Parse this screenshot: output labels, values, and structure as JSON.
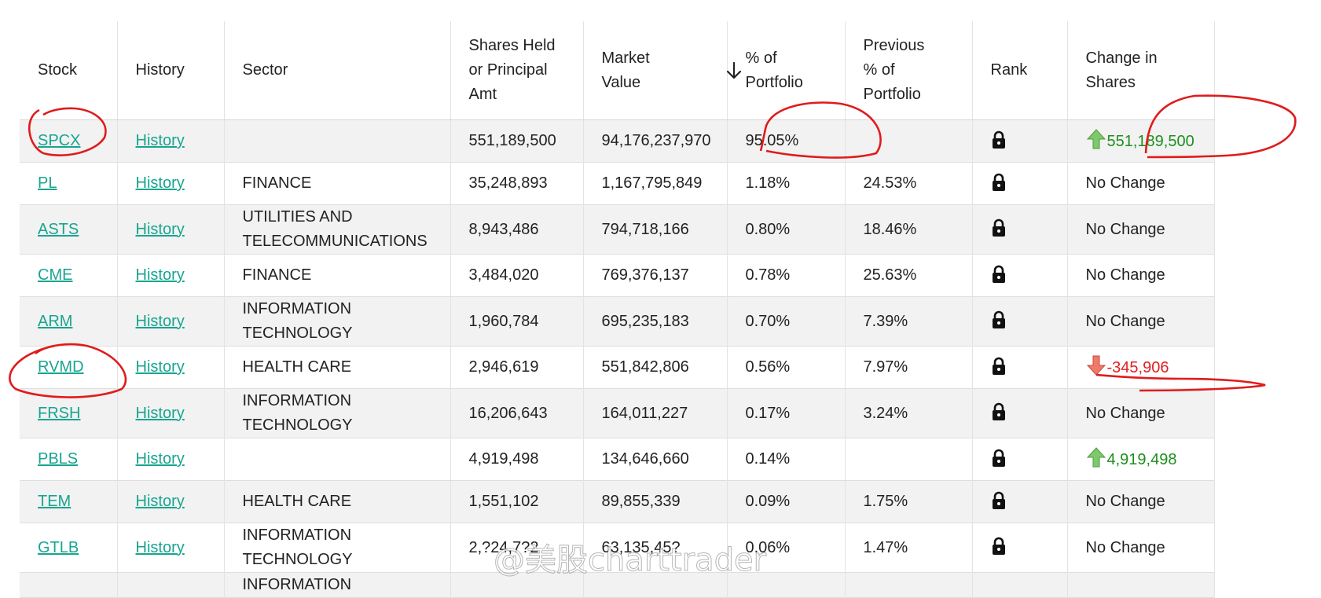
{
  "headers": {
    "stock": "Stock",
    "history": "History",
    "sector": "Sector",
    "shares": "Shares Held or Principal Amt",
    "market_value": "Market Value",
    "pct": "% of Portfolio",
    "prev_pct": "Previous % of Portfolio",
    "rank": "Rank",
    "change": "Change in Shares"
  },
  "rows": [
    {
      "stock": "SPCX",
      "history": "History",
      "sector": "",
      "shares": "551,189,500",
      "market_value": "94,176,237,970",
      "pct": "95.05%",
      "prev_pct": "",
      "change": "551,189,500",
      "change_dir": "up"
    },
    {
      "stock": "PL",
      "history": "History",
      "sector": "FINANCE",
      "shares": "35,248,893",
      "market_value": "1,167,795,849",
      "pct": "1.18%",
      "prev_pct": "24.53%",
      "change": "No Change",
      "change_dir": "none"
    },
    {
      "stock": "ASTS",
      "history": "History",
      "sector": "UTILITIES AND TELECOMMUNICATIONS",
      "shares": "8,943,486",
      "market_value": "794,718,166",
      "pct": "0.80%",
      "prev_pct": "18.46%",
      "change": "No Change",
      "change_dir": "none"
    },
    {
      "stock": "CME",
      "history": "History",
      "sector": "FINANCE",
      "shares": "3,484,020",
      "market_value": "769,376,137",
      "pct": "0.78%",
      "prev_pct": "25.63%",
      "change": "No Change",
      "change_dir": "none"
    },
    {
      "stock": "ARM",
      "history": "History",
      "sector": "INFORMATION TECHNOLOGY",
      "shares": "1,960,784",
      "market_value": "695,235,183",
      "pct": "0.70%",
      "prev_pct": "7.39%",
      "change": "No Change",
      "change_dir": "none"
    },
    {
      "stock": "RVMD",
      "history": "History",
      "sector": "HEALTH CARE",
      "shares": "2,946,619",
      "market_value": "551,842,806",
      "pct": "0.56%",
      "prev_pct": "7.97%",
      "change": "-345,906",
      "change_dir": "down"
    },
    {
      "stock": "FRSH",
      "history": "History",
      "sector": "INFORMATION TECHNOLOGY",
      "shares": "16,206,643",
      "market_value": "164,011,227",
      "pct": "0.17%",
      "prev_pct": "3.24%",
      "change": "No Change",
      "change_dir": "none"
    },
    {
      "stock": "PBLS",
      "history": "History",
      "sector": "",
      "shares": "4,919,498",
      "market_value": "134,646,660",
      "pct": "0.14%",
      "prev_pct": "",
      "change": "4,919,498",
      "change_dir": "up"
    },
    {
      "stock": "TEM",
      "history": "History",
      "sector": "HEALTH CARE",
      "shares": "1,551,102",
      "market_value": "89,855,339",
      "pct": "0.09%",
      "prev_pct": "1.75%",
      "change": "No Change",
      "change_dir": "none"
    },
    {
      "stock": "GTLB",
      "history": "History",
      "sector": "INFORMATION TECHNOLOGY",
      "shares": "2,?24,7?2",
      "market_value": "63,135,45?",
      "pct": "0.06%",
      "prev_pct": "1.47%",
      "change": "No Change",
      "change_dir": "none"
    }
  ],
  "partial_row": {
    "sector": "INFORMATION"
  },
  "watermark": "@美股charttrader",
  "colors": {
    "link": "#17a58f",
    "up": "#1d8f1d",
    "down": "#e02020",
    "annotation": "#e01b1b"
  },
  "icons": {
    "rank": "lock-icon",
    "sort": "arrow-down-icon"
  }
}
